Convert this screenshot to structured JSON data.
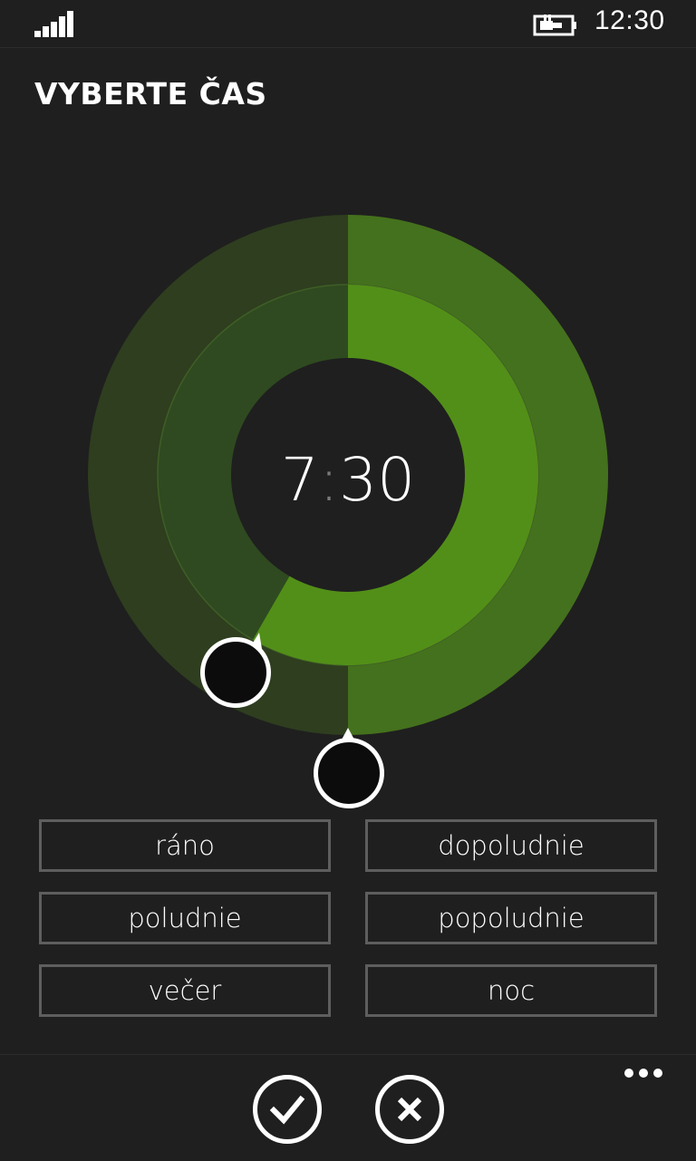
{
  "status": {
    "time": "12:30",
    "signal_icon": "signal-strength-icon",
    "battery_icon": "battery-charging-icon"
  },
  "header": {
    "title": "VYBERTE ČAS"
  },
  "picker": {
    "hours": "7",
    "separator": ":",
    "minutes": "30",
    "hour_value": 7,
    "minute_value": 30,
    "colors": {
      "outer_track": "#2e3e1f",
      "outer_fill": "#44711d",
      "inner_track": "#2f4a20",
      "inner_fill": "#528f18",
      "knob": "#0c0c0c"
    }
  },
  "periods": [
    {
      "label": "ráno"
    },
    {
      "label": "dopoludnie"
    },
    {
      "label": "poludnie"
    },
    {
      "label": "popoludnie"
    },
    {
      "label": "večer"
    },
    {
      "label": "noc"
    }
  ],
  "app_bar": {
    "confirm_icon": "checkmark-icon",
    "cancel_icon": "close-icon",
    "more_icon": "ellipsis-icon"
  }
}
